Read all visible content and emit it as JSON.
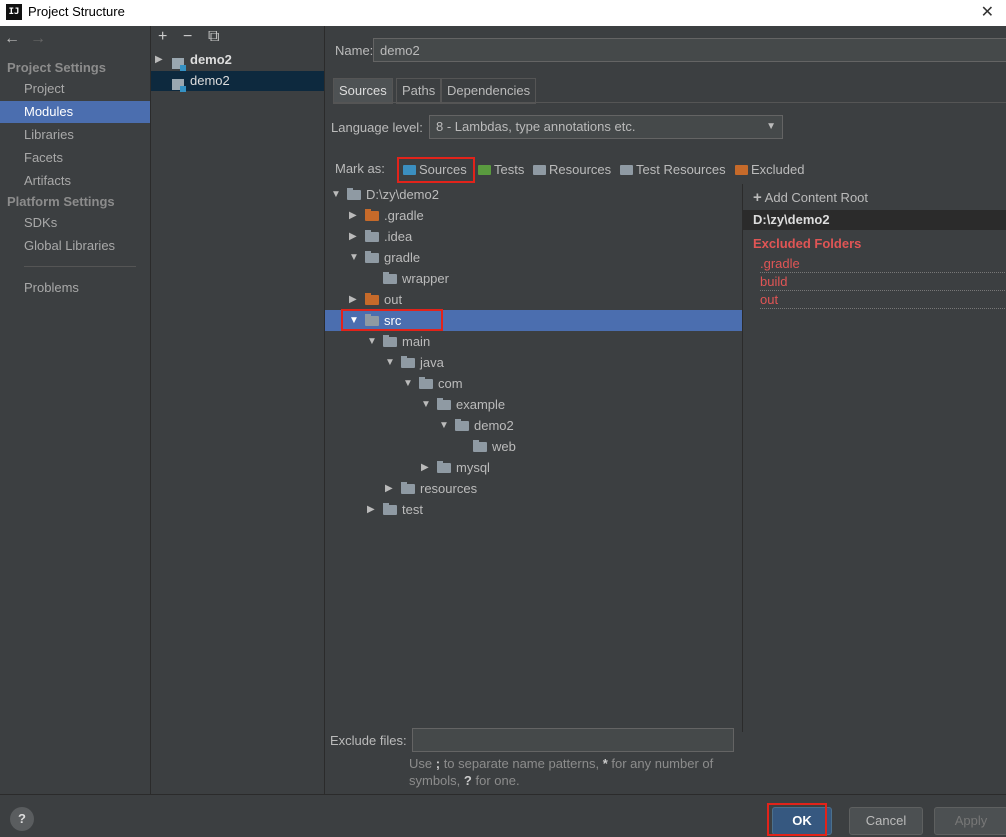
{
  "window": {
    "icon_text": "IJ",
    "title": "Project Structure",
    "close": "✕"
  },
  "nav": {
    "back": "←",
    "forward": "→",
    "project_settings_heading": "Project Settings",
    "project_settings": [
      "Project",
      "Modules",
      "Libraries",
      "Facets",
      "Artifacts"
    ],
    "platform_settings_heading": "Platform Settings",
    "platform_settings": [
      "SDKs",
      "Global Libraries"
    ],
    "problems": "Problems",
    "selected": "Modules"
  },
  "modules": {
    "toolbar": {
      "add": "+",
      "remove": "−",
      "copy": "⧉"
    },
    "items": [
      {
        "label": "demo2",
        "bold": true,
        "expandable": true
      },
      {
        "label": "demo2",
        "bold": false,
        "selected": true
      }
    ]
  },
  "module": {
    "name_label": "Name:",
    "name_value": "demo2",
    "tabs": [
      "Sources",
      "Paths",
      "Dependencies"
    ],
    "active_tab": "Sources",
    "language_level_label": "Language level:",
    "language_level_value": "8 - Lambdas, type annotations etc.",
    "mark_as_label": "Mark as:",
    "mark_as": [
      {
        "label": "Sources",
        "color": "#3b8fc0"
      },
      {
        "label": "Tests",
        "color": "#5a9b3f"
      },
      {
        "label": "Resources",
        "color": "#8f9aa3"
      },
      {
        "label": "Test Resources",
        "color": "#8f9aa3"
      },
      {
        "label": "Excluded",
        "color": "#c66a2a"
      }
    ]
  },
  "tree": [
    {
      "label": "D:\\zy\\demo2",
      "depth": 0,
      "arrow": "▼",
      "folder": "normal"
    },
    {
      "label": ".gradle",
      "depth": 1,
      "arrow": "▶",
      "folder": "excluded"
    },
    {
      "label": ".idea",
      "depth": 1,
      "arrow": "▶",
      "folder": "normal"
    },
    {
      "label": "gradle",
      "depth": 1,
      "arrow": "▼",
      "folder": "normal"
    },
    {
      "label": "wrapper",
      "depth": 2,
      "arrow": "",
      "folder": "normal"
    },
    {
      "label": "out",
      "depth": 1,
      "arrow": "▶",
      "folder": "excluded"
    },
    {
      "label": "src",
      "depth": 1,
      "arrow": "▼",
      "folder": "normal",
      "selected": true
    },
    {
      "label": "main",
      "depth": 2,
      "arrow": "▼",
      "folder": "normal"
    },
    {
      "label": "java",
      "depth": 3,
      "arrow": "▼",
      "folder": "normal"
    },
    {
      "label": "com",
      "depth": 4,
      "arrow": "▼",
      "folder": "normal"
    },
    {
      "label": "example",
      "depth": 5,
      "arrow": "▼",
      "folder": "normal"
    },
    {
      "label": "demo2",
      "depth": 6,
      "arrow": "▼",
      "folder": "normal"
    },
    {
      "label": "web",
      "depth": 7,
      "arrow": "",
      "folder": "normal"
    },
    {
      "label": "mysql",
      "depth": 5,
      "arrow": "▶",
      "folder": "normal"
    },
    {
      "label": "resources",
      "depth": 3,
      "arrow": "▶",
      "folder": "normal"
    },
    {
      "label": "test",
      "depth": 2,
      "arrow": "▶",
      "folder": "normal"
    }
  ],
  "content_root": {
    "add_label": "Add Content Root",
    "add_icon": "+",
    "path": "D:\\zy\\demo2",
    "excluded_heading": "Excluded Folders",
    "excluded": [
      ".gradle",
      "build",
      "out"
    ]
  },
  "exclude_files": {
    "label": "Exclude files:",
    "value": "",
    "hint_1": "Use ",
    "hint_semicolon": ";",
    "hint_2": " to separate name patterns, ",
    "hint_star": "*",
    "hint_3": " for any number of symbols, ",
    "hint_q": "?",
    "hint_4": " for one."
  },
  "buttons": {
    "help": "?",
    "ok": "OK",
    "cancel": "Cancel",
    "apply": "Apply"
  }
}
